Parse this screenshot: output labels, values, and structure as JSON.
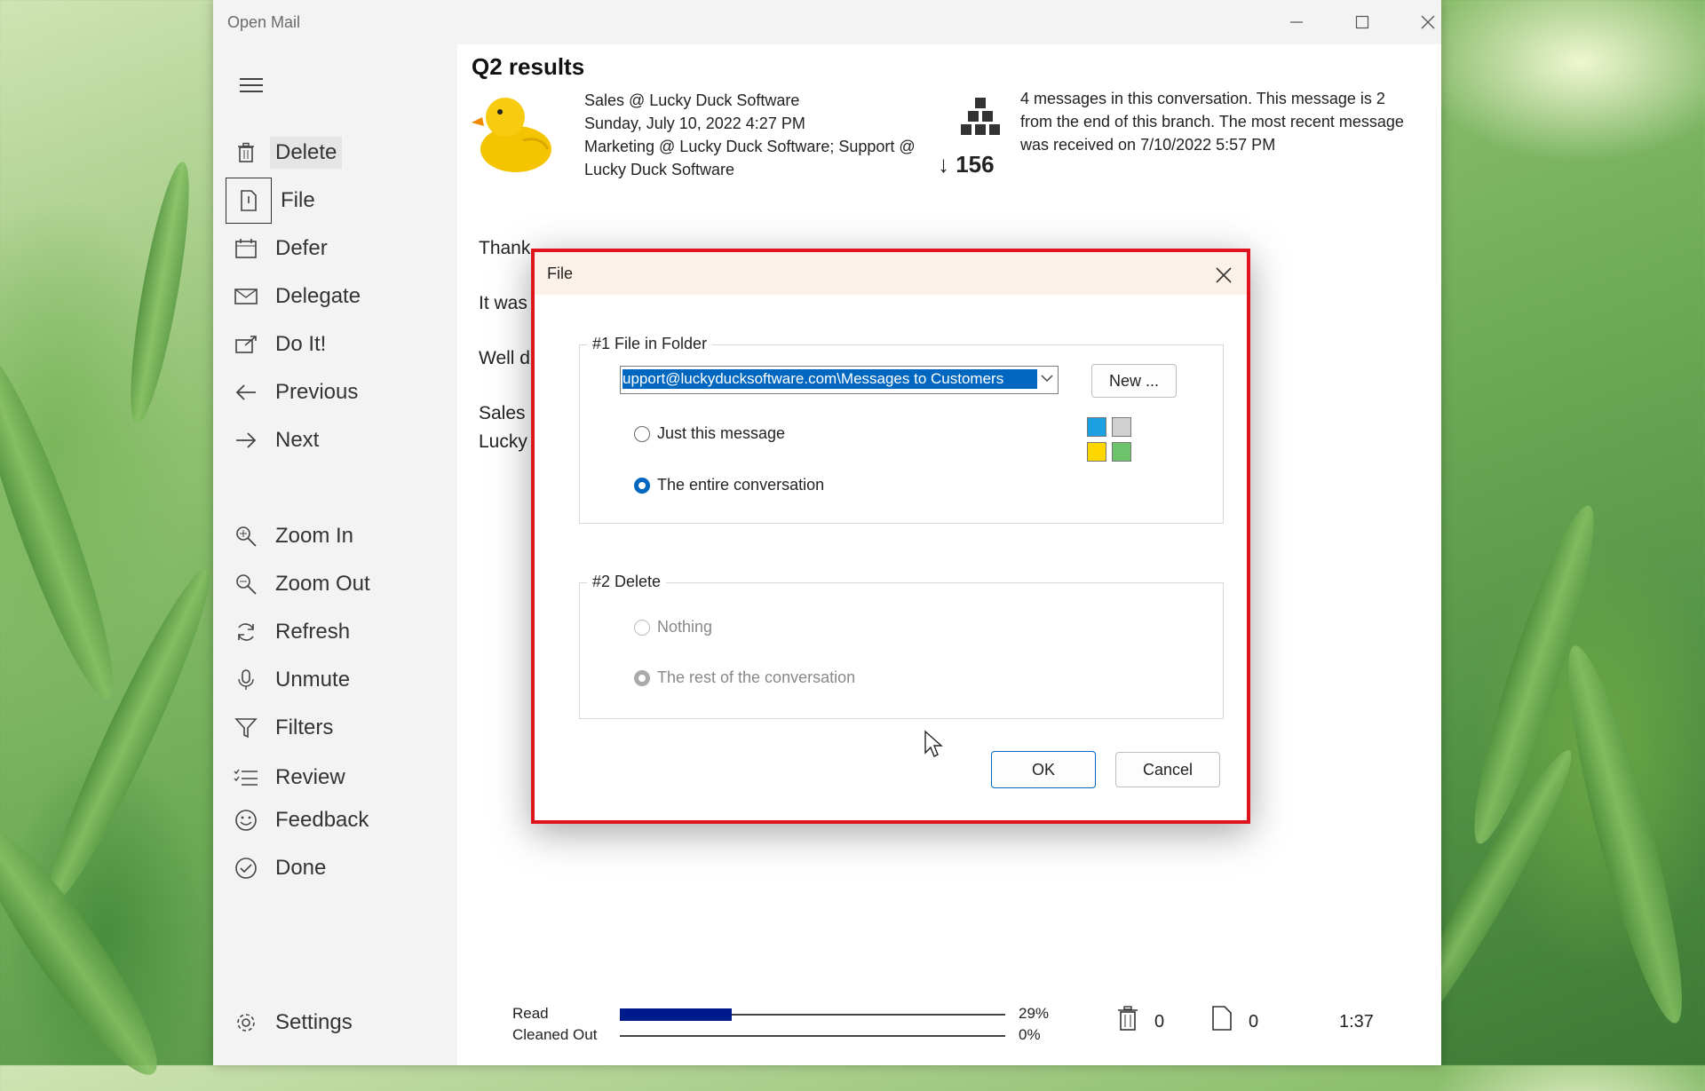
{
  "window": {
    "app_title": "Open Mail"
  },
  "sidebar": {
    "items": [
      {
        "label": "Delete",
        "icon": "trash-icon"
      },
      {
        "label": "File",
        "icon": "file-icon"
      },
      {
        "label": "Defer",
        "icon": "calendar-icon"
      },
      {
        "label": "Delegate",
        "icon": "envelope-forward-icon"
      },
      {
        "label": "Do It!",
        "icon": "do-it-icon"
      },
      {
        "label": "Previous",
        "icon": "arrow-left-icon"
      },
      {
        "label": "Next",
        "icon": "arrow-right-icon"
      },
      {
        "label": "Zoom In",
        "icon": "zoom-in-icon"
      },
      {
        "label": "Zoom Out",
        "icon": "zoom-out-icon"
      },
      {
        "label": "Refresh",
        "icon": "refresh-icon"
      },
      {
        "label": "Unmute",
        "icon": "microphone-icon"
      },
      {
        "label": "Filters",
        "icon": "filter-icon"
      },
      {
        "label": "Review",
        "icon": "review-list-icon"
      },
      {
        "label": "Feedback",
        "icon": "smiley-icon"
      },
      {
        "label": "Done",
        "icon": "check-circle-icon"
      },
      {
        "label": "Settings",
        "icon": "gear-icon"
      }
    ]
  },
  "message": {
    "subject": "Q2 results",
    "from": "Sales @ Lucky Duck Software",
    "date": "Sunday, July 10, 2022 4:27 PM",
    "to": "Marketing @ Lucky Duck Software; Support @ Lucky Duck Software",
    "count": "↓ 156",
    "conversation_info": "4 messages in this conversation. This message is 2 from the end of this branch. The most recent message was received on 7/10/2022 5:57 PM",
    "body": [
      "Thank",
      "It was",
      "Well d",
      "Sales",
      "Lucky"
    ]
  },
  "status": {
    "read_label": "Read",
    "cleaned_label": "Cleaned Out",
    "read_percent": "29%",
    "cleaned_percent": "0%",
    "read_fraction": 0.29,
    "cleaned_fraction": 0,
    "deleted_count": "0",
    "filed_count": "0",
    "time": "1:37"
  },
  "dialog": {
    "title": "File",
    "group1_legend": "#1  File in Folder",
    "folder_value": "upport@luckyducksoftware.com\\Messages to Customers",
    "new_button": "New ...",
    "radio_just_this": "Just this message",
    "radio_entire": "The entire conversation",
    "group2_legend": "#2  Delete",
    "radio_nothing": "Nothing",
    "radio_rest": "The rest of the conversation",
    "ok_button": "OK",
    "cancel_button": "Cancel",
    "tile_colors": [
      "#1ba1e2",
      "#d0d0d0",
      "#ffd700",
      "#6cc36c"
    ]
  },
  "colors": {
    "accent": "#0067c0",
    "highlight_border": "#e0141e",
    "progress": "#001a8c"
  }
}
